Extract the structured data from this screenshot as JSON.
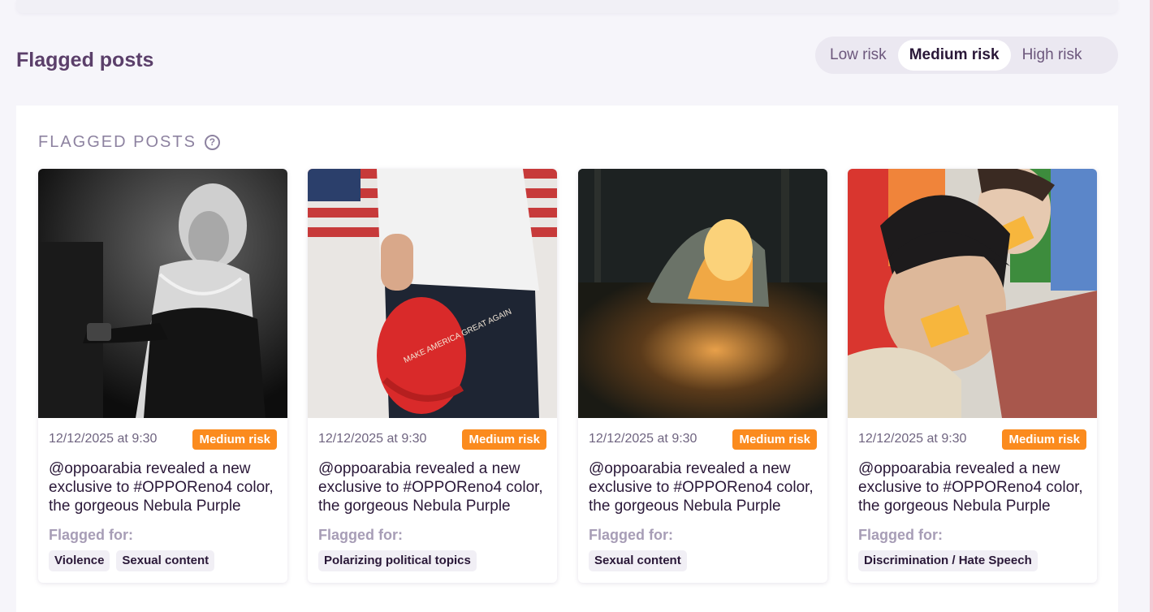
{
  "section_title": "Flagged posts",
  "risk_filter": {
    "options": [
      "Low risk",
      "Medium risk",
      "High risk"
    ],
    "selected": "Medium risk"
  },
  "panel": {
    "title": "FLAGGED POSTS",
    "help_icon": "question-circle-icon"
  },
  "flagged_for_label": "Flagged for:",
  "colors": {
    "badge": "#fb8b1e",
    "title": "#5b3f6a",
    "tag_bg": "#f1eff5"
  },
  "posts": [
    {
      "image": "woman-black-white-photo",
      "date": "12/12/2025 at 9:30",
      "risk": "Medium risk",
      "caption": "@oppoarabia revealed a new exclusive to #OPPOReno4 color, the gorgeous Nebula Purple",
      "tags": [
        "Violence",
        "Sexual content"
      ]
    },
    {
      "image": "red-cap-flag-photo",
      "image_text": "MAKE AMERICA GREAT AGAIN",
      "date": "12/12/2025 at 9:30",
      "risk": "Medium risk",
      "caption": "@oppoarabia revealed a new exclusive to #OPPOReno4 color, the gorgeous Nebula Purple",
      "tags": [
        "Polarizing political topics"
      ]
    },
    {
      "image": "tent-forest-photo",
      "date": "12/12/2025 at 9:30",
      "risk": "Medium risk",
      "caption": "@oppoarabia revealed a new exclusive to #OPPOReno4 color, the gorgeous Nebula Purple",
      "tags": [
        "Sexual content"
      ]
    },
    {
      "image": "taped-mouth-photo",
      "date": "12/12/2025 at 9:30",
      "risk": "Medium risk",
      "caption": "@oppoarabia revealed a new exclusive to #OPPOReno4 color, the gorgeous Nebula Purple",
      "tags": [
        "Discrimination / Hate Speech"
      ]
    }
  ]
}
